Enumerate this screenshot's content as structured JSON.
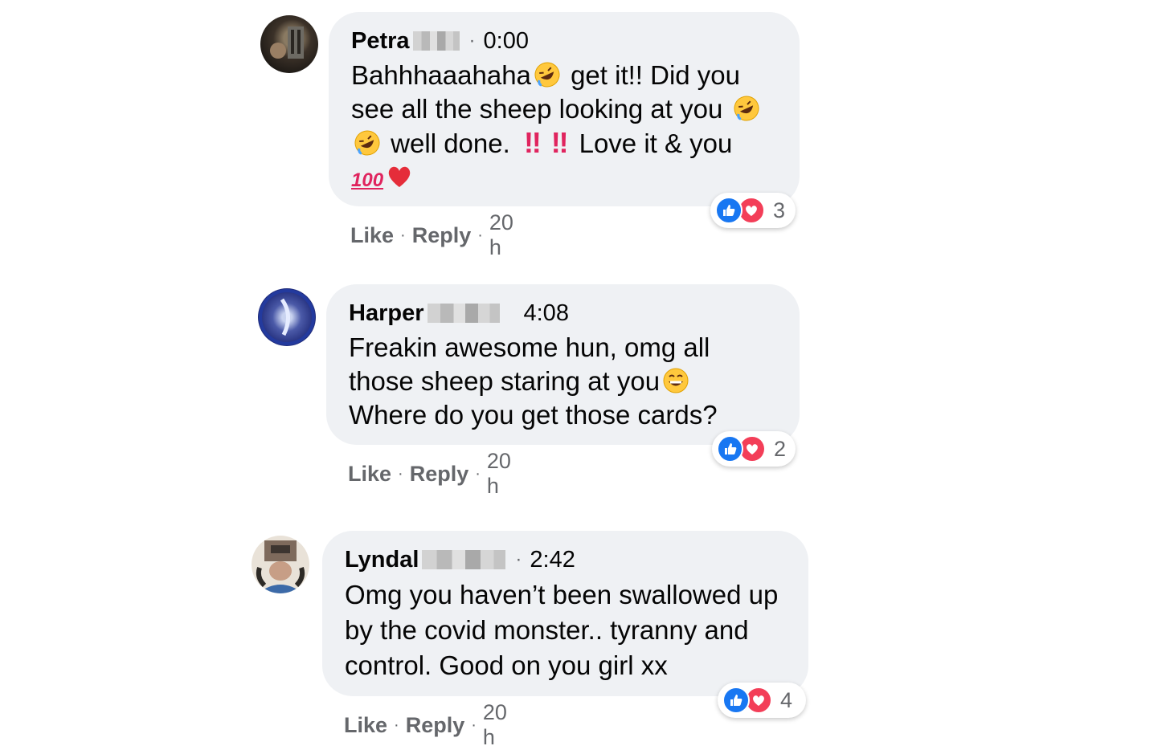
{
  "comments": [
    {
      "author": "Petra",
      "time": "0:00",
      "text_parts": [
        "Bahhhaaahaha",
        " get it!! Did you see all the sheep looking at you ",
        "well done. ",
        " Love it & you"
      ],
      "emoji_labels": {
        "hundred": "100"
      },
      "actions": {
        "like": "Like",
        "reply": "Reply",
        "age": "20 h"
      },
      "reaction_count": "3",
      "reactions": [
        "like-icon",
        "love-icon"
      ]
    },
    {
      "author": "Harper",
      "time": "4:08",
      "text_parts": [
        "Freakin awesome hun, omg all those sheep staring at you",
        "Where do you get those cards?"
      ],
      "actions": {
        "like": "Like",
        "reply": "Reply",
        "age": "20 h"
      },
      "reaction_count": "2",
      "reactions": [
        "like-icon",
        "love-icon"
      ]
    },
    {
      "author": "Lyndal",
      "time": "2:42",
      "text_parts": [
        "Omg you haven’t been swallowed up by the covid monster.. tyranny and control. Good on you girl xx"
      ],
      "actions": {
        "like": "Like",
        "reply": "Reply",
        "age": "20 h"
      },
      "reaction_count": "4",
      "reactions": [
        "like-icon",
        "love-icon"
      ]
    }
  ],
  "separator": "·",
  "colors": {
    "bubble": "#eff1f4",
    "meta_text": "#65676b",
    "like_blue": "#1877f2",
    "love_red": "#f33e58"
  }
}
